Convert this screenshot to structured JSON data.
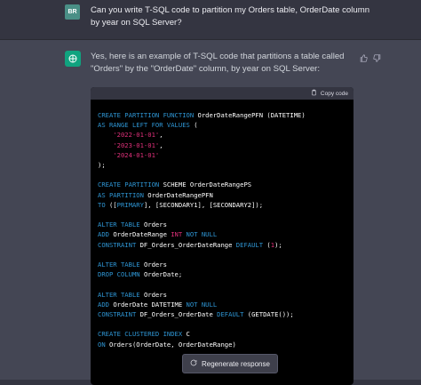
{
  "user": {
    "avatar": "BR",
    "message": "Can you write T-SQL code to partition my Orders table, OrderDate column by year on SQL Server?"
  },
  "assistant": {
    "intro": "Yes, here is an example of T-SQL code that partitions a table called \"Orders\" by the \"OrderDate\" column, by year on SQL Server:",
    "copy_label": "Copy code",
    "icons": {
      "logo": "openai-logo-icon",
      "thumb_up": "thumb-up-icon",
      "thumb_down": "thumb-down-icon",
      "copy": "clipboard-icon",
      "regen": "refresh-icon"
    }
  },
  "code_lines": [
    [
      [
        "kw",
        "CREATE PARTITION FUNCTION "
      ],
      [
        "",
        "OrderDateRangePFN (DATETIME)"
      ]
    ],
    [
      [
        "kw",
        "AS RANGE LEFT FOR VALUES "
      ],
      [
        "",
        "("
      ]
    ],
    [
      [
        "",
        "    "
      ],
      [
        "str",
        "'2022-01-01'"
      ],
      [
        "",
        ","
      ]
    ],
    [
      [
        "",
        "    "
      ],
      [
        "str",
        "'2023-01-01'"
      ],
      [
        "",
        ","
      ]
    ],
    [
      [
        "",
        "    "
      ],
      [
        "str",
        "'2024-01-01'"
      ]
    ],
    [
      [
        "",
        ");"
      ]
    ],
    [
      [
        "",
        ""
      ]
    ],
    [
      [
        "kw",
        "CREATE PARTITION "
      ],
      [
        "",
        "SCHEME OrderDateRangePS"
      ]
    ],
    [
      [
        "kw",
        "AS PARTITION "
      ],
      [
        "",
        "OrderDateRangePFN"
      ]
    ],
    [
      [
        "kw",
        "TO "
      ],
      [
        "",
        "(["
      ],
      [
        "kw",
        "PRIMARY"
      ],
      [
        "",
        "], [SECONDARY1], [SECONDARY2]);"
      ]
    ],
    [
      [
        "",
        ""
      ]
    ],
    [
      [
        "kw",
        "ALTER TABLE "
      ],
      [
        "",
        "Orders"
      ]
    ],
    [
      [
        "kw",
        "ADD "
      ],
      [
        "",
        "OrderDateRange "
      ],
      [
        "str",
        "INT "
      ],
      [
        "kw",
        "NOT NULL"
      ]
    ],
    [
      [
        "kw",
        "CONSTRAINT "
      ],
      [
        "",
        "DF_Orders_OrderDateRange "
      ],
      [
        "kw",
        "DEFAULT "
      ],
      [
        "",
        "("
      ],
      [
        "num",
        "1"
      ],
      [
        "",
        ");"
      ]
    ],
    [
      [
        "",
        ""
      ]
    ],
    [
      [
        "kw",
        "ALTER TABLE "
      ],
      [
        "",
        "Orders"
      ]
    ],
    [
      [
        "kw",
        "DROP COLUMN "
      ],
      [
        "",
        "OrderDate;"
      ]
    ],
    [
      [
        "",
        ""
      ]
    ],
    [
      [
        "kw",
        "ALTER TABLE "
      ],
      [
        "",
        "Orders"
      ]
    ],
    [
      [
        "kw",
        "ADD "
      ],
      [
        "",
        "OrderDate DATETIME "
      ],
      [
        "kw",
        "NOT NULL"
      ]
    ],
    [
      [
        "kw",
        "CONSTRAINT "
      ],
      [
        "",
        "DF_Orders_OrderDate "
      ],
      [
        "kw",
        "DEFAULT "
      ],
      [
        "",
        "(GETDATE());"
      ]
    ],
    [
      [
        "",
        ""
      ]
    ],
    [
      [
        "kw",
        "CREATE CLUSTERED INDEX "
      ],
      [
        "",
        "C"
      ]
    ],
    [
      [
        "kw",
        "ON "
      ],
      [
        "",
        "Orders(OrderDate, OrderDateRange)"
      ]
    ]
  ],
  "regenerate_label": "Regenerate response"
}
